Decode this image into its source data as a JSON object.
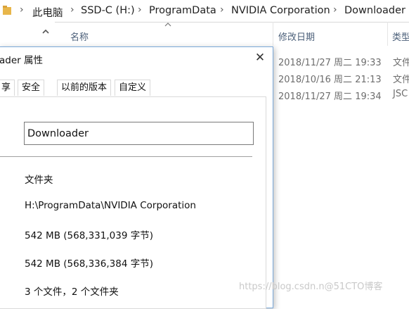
{
  "addressbar": {
    "crumbs": [
      "此电脑",
      "SSD-C (H:)",
      "ProgramData",
      "NVIDIA Corporation",
      "Downloader"
    ],
    "separator": "›"
  },
  "columns": {
    "name": "名称",
    "date": "修改日期",
    "type": "类型"
  },
  "files": [
    {
      "date": "2018/11/27 周二 19:33",
      "type": "文件"
    },
    {
      "date": "2018/10/16 周二 21:13",
      "type": "文件"
    },
    {
      "date": "2018/11/27 周二 19:34",
      "type": "JSC"
    }
  ],
  "dialog": {
    "title": "ader 属性",
    "close_glyph": "✕",
    "tabs": [
      "享",
      "安全",
      "以前的版本",
      "自定义"
    ],
    "name_value": "Downloader",
    "type_value": "文件夹",
    "location_value": "H:\\ProgramData\\NVIDIA Corporation",
    "size_value": "542 MB (568,331,039 字节)",
    "size_on_disk_value": "542 MB (568,336,384 字节)",
    "contains_value": "3 个文件，2 个文件夹"
  },
  "watermark": "https://blog.csdn.n@51CTO博客",
  "colors": {
    "folder_yellow": "#e8b64a",
    "dialog_border": "#7aa8d8",
    "header_text": "#4c607a"
  },
  "icons": [
    "folder-icon",
    "scroll-up-icon",
    "sort-up-icon",
    "close-icon"
  ]
}
